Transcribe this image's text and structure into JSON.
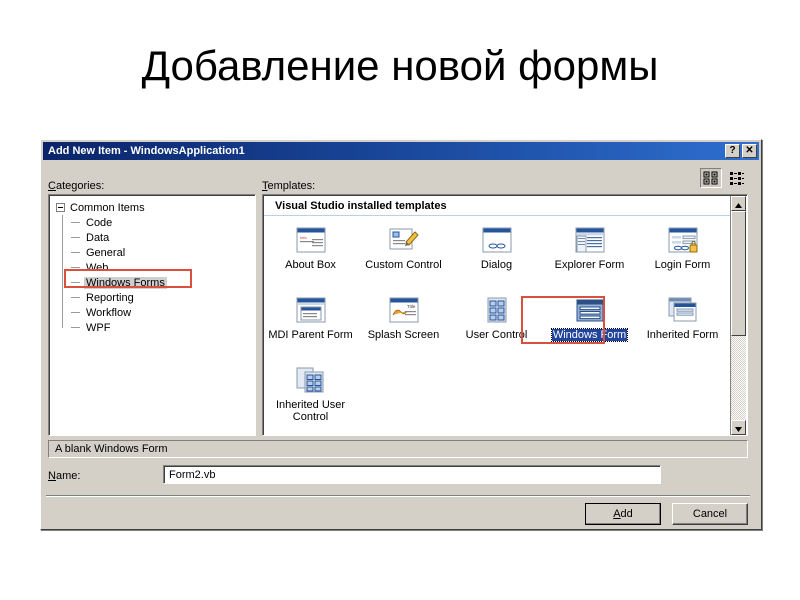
{
  "slide": {
    "title": "Добавление новой формы",
    "background": "#ffffff"
  },
  "dialog": {
    "title": "Add New Item - WindowsApplication1",
    "titlebar_color": "#0a246a",
    "face_color": "#d4d0c8",
    "titlebar_buttons": [
      {
        "name": "help-button",
        "label": "?"
      },
      {
        "name": "close-button",
        "label": "✕"
      }
    ],
    "labels": {
      "categories_prefix": "C",
      "categories_rest": "ategories:",
      "templates_prefix": "T",
      "templates_rest": "emplates:",
      "name_prefix": "N",
      "name_rest": "ame:"
    },
    "view_modes": [
      {
        "name": "large-icons-view-button",
        "icon": "large-icons-icon",
        "selected": true
      },
      {
        "name": "list-view-button",
        "icon": "list-view-icon",
        "selected": false
      }
    ],
    "categories_tree": {
      "root": "Common Items",
      "expanded": true,
      "children": [
        {
          "label": "Code",
          "selected": false
        },
        {
          "label": "Data",
          "selected": false
        },
        {
          "label": "General",
          "selected": false
        },
        {
          "label": "Web",
          "selected": false
        },
        {
          "label": "Windows Forms",
          "selected": true
        },
        {
          "label": "Reporting",
          "selected": false
        },
        {
          "label": "Workflow",
          "selected": false
        },
        {
          "label": "WPF",
          "selected": false
        }
      ]
    },
    "templates": {
      "header": "Visual Studio installed templates",
      "items": [
        {
          "label": "About Box",
          "icon": "about-box-icon",
          "selected": false
        },
        {
          "label": "Custom Control",
          "icon": "custom-control-icon",
          "selected": false
        },
        {
          "label": "Dialog",
          "icon": "dialog-icon",
          "selected": false
        },
        {
          "label": "Explorer Form",
          "icon": "explorer-form-icon",
          "selected": false
        },
        {
          "label": "Login Form",
          "icon": "login-form-icon",
          "selected": false
        },
        {
          "label": "MDI Parent Form",
          "icon": "mdi-parent-form-icon",
          "selected": false
        },
        {
          "label": "Splash Screen",
          "icon": "splash-screen-icon",
          "selected": false
        },
        {
          "label": "User Control",
          "icon": "user-control-icon",
          "selected": false
        },
        {
          "label": "Windows Form",
          "icon": "windows-form-icon",
          "selected": true
        },
        {
          "label": "Inherited Form",
          "icon": "inherited-form-icon",
          "selected": false
        },
        {
          "label": "Inherited User Control",
          "icon": "inherited-user-control-icon",
          "selected": false
        }
      ],
      "scrollbar": {
        "up_arrow": "▲",
        "down_arrow": "▼",
        "thumb_position": "top"
      }
    },
    "description": "A blank Windows Form",
    "name_field": {
      "value": "Form2.vb",
      "placeholder": ""
    },
    "buttons": [
      {
        "name": "add-button",
        "prefix": "A",
        "rest": "dd",
        "default": true
      },
      {
        "name": "cancel-button",
        "prefix": "",
        "rest": "Cancel",
        "default": false
      }
    ],
    "add_button": {
      "prefix": "A",
      "rest": "dd"
    },
    "cancel_button": {
      "label": "Cancel"
    }
  },
  "annotations": {
    "color": "#d9503c",
    "boxes": [
      {
        "name": "annotation-windows-forms-category",
        "target": "Windows Forms"
      },
      {
        "name": "annotation-windows-form-template",
        "target": "Windows Form"
      }
    ]
  }
}
